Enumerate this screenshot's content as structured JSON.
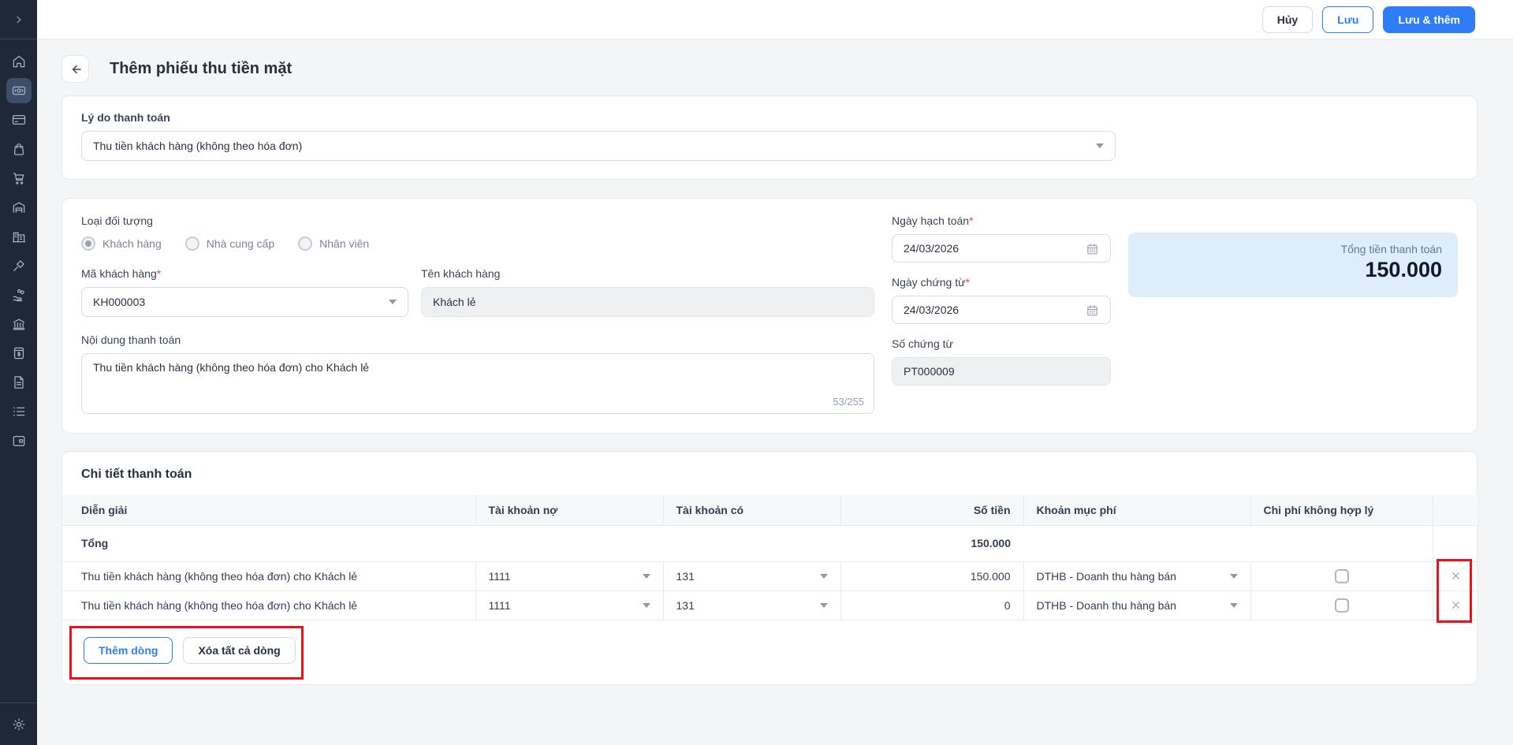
{
  "colors": {
    "accent_blue": "#2e7df6",
    "sidebar_bg": "#1e2836",
    "annotation_red": "#e8131d",
    "total_panel_bg": "#ddedfb",
    "required_red": "#e5484d"
  },
  "sidebar": {
    "icon_names": [
      "chevron-right",
      "home",
      "cash-register",
      "credit-card",
      "shopping-bag",
      "shopping-cart",
      "warehouse",
      "company",
      "tools",
      "hand-coins",
      "bank",
      "invoice-money",
      "document",
      "list",
      "wallet",
      "settings"
    ],
    "active_icon": "cash-register"
  },
  "topbar": {
    "cancel_label": "Hủy",
    "save_label": "Lưu",
    "save_add_label": "Lưu & thêm"
  },
  "page": {
    "title": "Thêm phiếu thu tiền mặt"
  },
  "reason": {
    "label": "Lý do thanh toán",
    "value": "Thu tiền khách hàng (không theo hóa đơn)"
  },
  "info": {
    "object_type_label": "Loại đối tượng",
    "object_options": [
      {
        "label": "Khách hàng",
        "selected": true
      },
      {
        "label": "Nhà cung cấp",
        "selected": false
      },
      {
        "label": "Nhân viên",
        "selected": false
      }
    ],
    "customer_code": {
      "label": "Mã khách hàng",
      "required": "*",
      "value": "KH000003"
    },
    "customer_name": {
      "label": "Tên khách hàng",
      "value": "Khách lẻ"
    },
    "payment_content": {
      "label": "Nội dung thanh toán",
      "value": "Thu tiền khách hàng (không theo hóa đơn) cho Khách lẻ",
      "counter": "53/255"
    },
    "posting_date": {
      "label": "Ngày hạch toán",
      "required": "*",
      "value": "24/03/2026"
    },
    "document_date": {
      "label": "Ngày chứng từ",
      "required": "*",
      "value": "24/03/2026"
    },
    "document_no": {
      "label": "Số chứng từ",
      "value": "PT000009"
    },
    "total_panel": {
      "label": "Tổng tiền thanh toán",
      "value": "150.000"
    }
  },
  "detail": {
    "title": "Chi tiết thanh toán",
    "columns": [
      "Diễn giải",
      "Tài khoản nợ",
      "Tài khoản có",
      "Số tiền",
      "Khoản mục phí",
      "Chi phí không hợp lý"
    ],
    "total_label": "Tổng",
    "total_amount": "150.000",
    "rows": [
      {
        "description": "Thu tiền khách hàng (không theo hóa đơn) cho Khách lẻ",
        "debit_account": "1111",
        "credit_account": "131",
        "amount": "150.000",
        "expense_item": "DTHB - Doanh thu hàng bán",
        "unreasonable_expense": false
      },
      {
        "description": "Thu tiền khách hàng (không theo hóa đơn) cho Khách lẻ",
        "debit_account": "1111",
        "credit_account": "131",
        "amount": "0",
        "expense_item": "DTHB - Doanh thu hàng bán",
        "unreasonable_expense": false
      }
    ],
    "add_row_label": "Thêm dòng",
    "delete_all_label": "Xóa tất cả dòng"
  }
}
